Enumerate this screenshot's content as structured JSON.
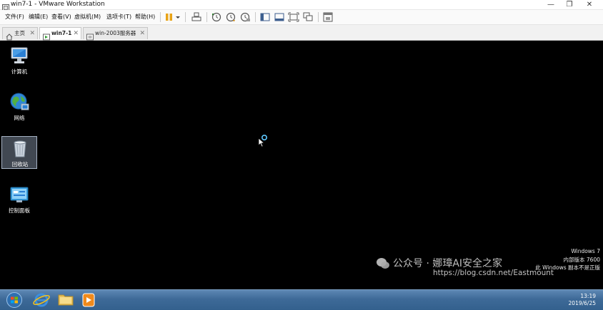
{
  "window": {
    "title": "win7-1 - VMware Workstation",
    "controls": {
      "minimize": "—",
      "maximize": "❐",
      "close": "✕"
    }
  },
  "menu": {
    "items": [
      "文件(F)",
      "编辑(E)",
      "查看(V)",
      "虚拟机(M)",
      "选项卡(T)",
      "帮助(H)"
    ]
  },
  "tabs": [
    {
      "label": "主页",
      "icon": "home-icon",
      "close": "✕"
    },
    {
      "label": "win7-1",
      "icon": "vm-running-icon",
      "close": "✕"
    },
    {
      "label": "win-2003服务器",
      "icon": "vm-icon",
      "close": "✕"
    }
  ],
  "desktop": {
    "icons": [
      {
        "label": "计算机",
        "icon": "computer-icon"
      },
      {
        "label": "网络",
        "icon": "network-globe-icon"
      },
      {
        "label": "回收站",
        "icon": "recycle-bin-icon"
      },
      {
        "label": "控制面板",
        "icon": "control-panel-icon"
      }
    ]
  },
  "watermark": {
    "lines": [
      "Windows 7",
      "内部版本 7600",
      "此 Windows 副本不是正版"
    ],
    "overlay_text": "公众号 · 娜璋AI安全之家",
    "url": "https://blog.csdn.net/Eastmount"
  },
  "taskbar": {
    "apps": [
      "start-orb-icon",
      "internet-explorer-icon",
      "folder-icon",
      "media-player-icon"
    ],
    "time": "13:19",
    "date": "2019/6/25"
  },
  "colors": {
    "desktop": "#000000",
    "taskbar": "#3e6a98",
    "pause_accent": "#e8a317"
  }
}
